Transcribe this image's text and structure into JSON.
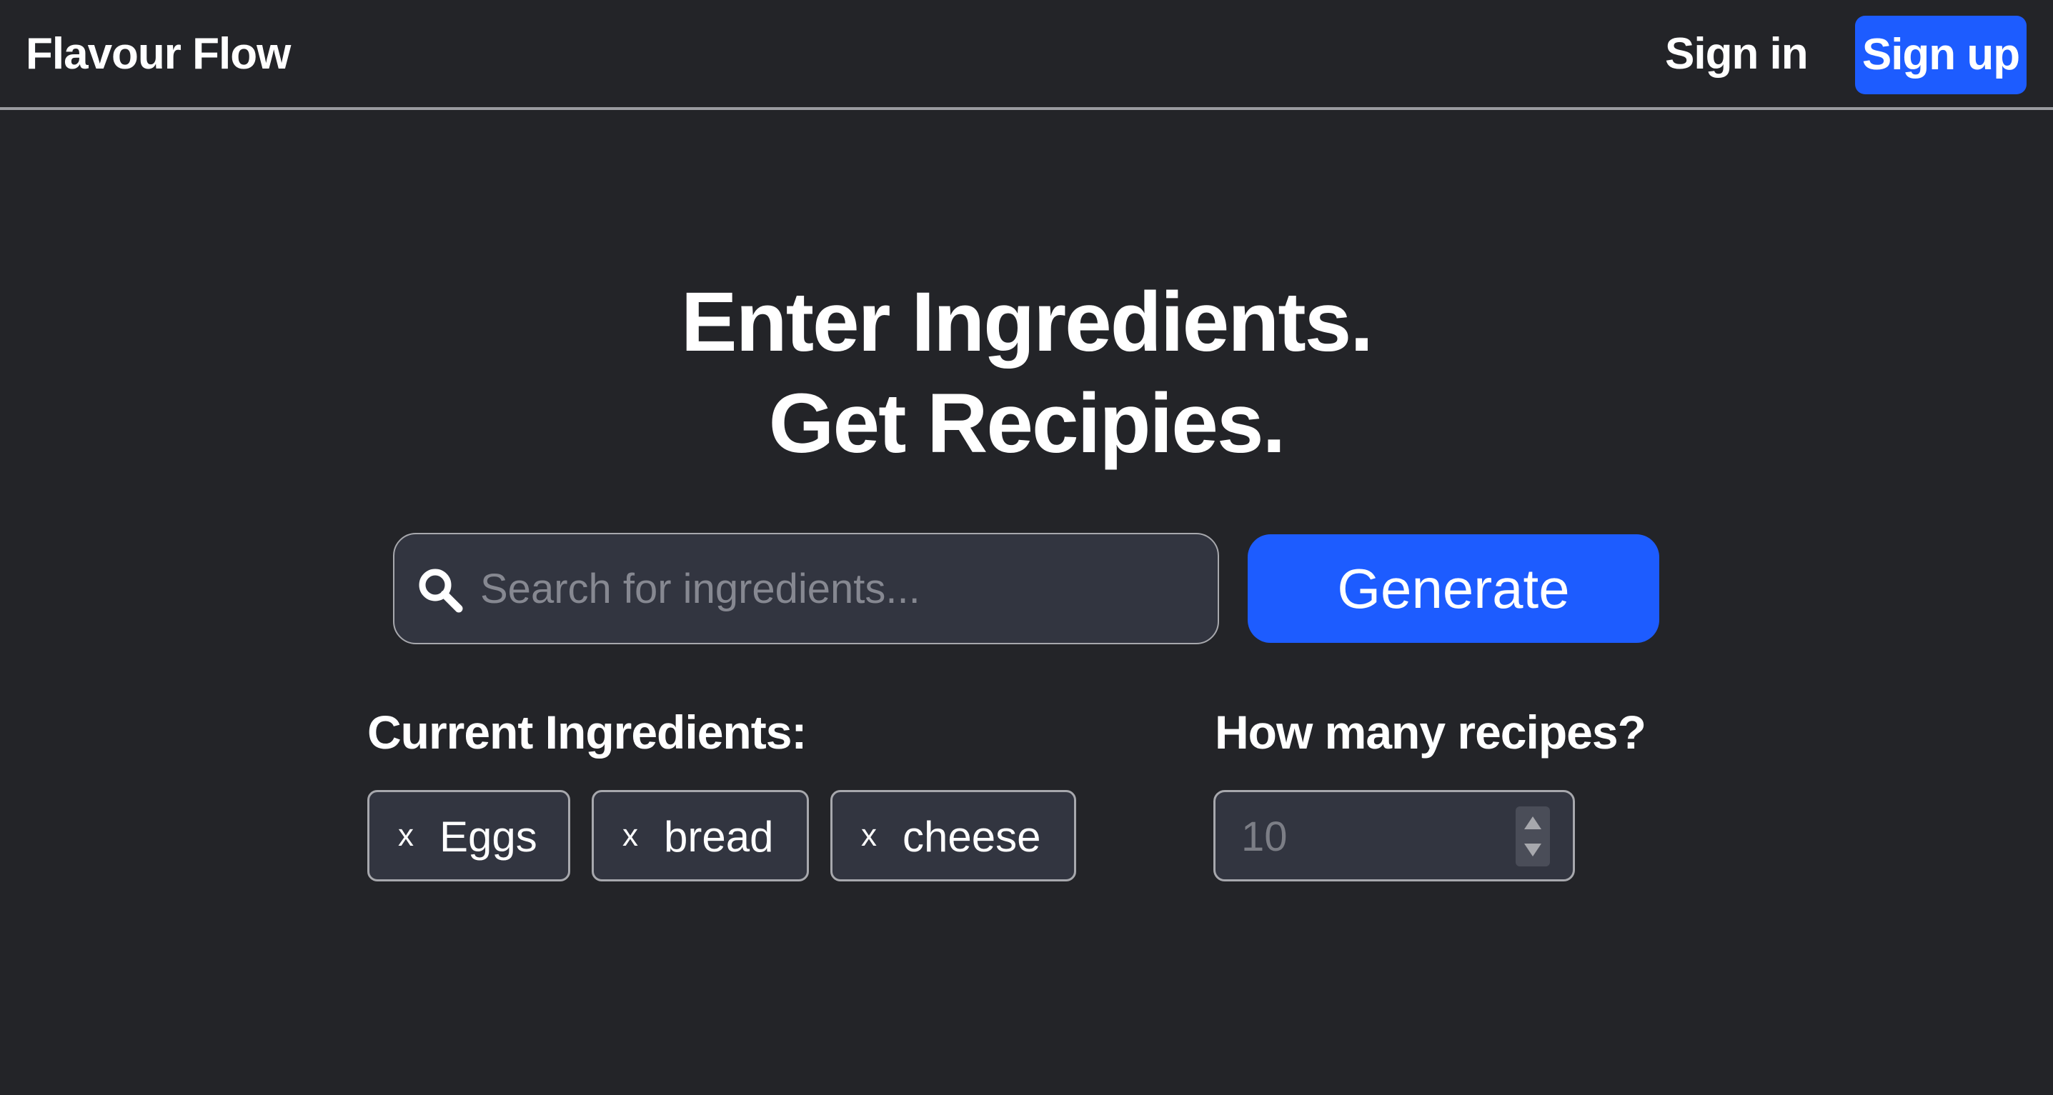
{
  "header": {
    "brand": "Flavour Flow",
    "sign_in": "Sign in",
    "sign_up": "Sign up"
  },
  "hero": {
    "line1": "Enter Ingredients.",
    "line2": "Get Recipies."
  },
  "search": {
    "placeholder": "Search for ingredients...",
    "value": "",
    "icon": "search-icon"
  },
  "generate_label": "Generate",
  "ingredients": {
    "label": "Current Ingredients:",
    "remove_symbol": "x",
    "items": [
      "Eggs",
      "bread",
      "cheese"
    ]
  },
  "recipes": {
    "label": "How many recipes?",
    "value": "10"
  },
  "colors": {
    "background": "#232428",
    "accent": "#1d5cff",
    "field": "#323540",
    "border": "#a7a8ad"
  }
}
